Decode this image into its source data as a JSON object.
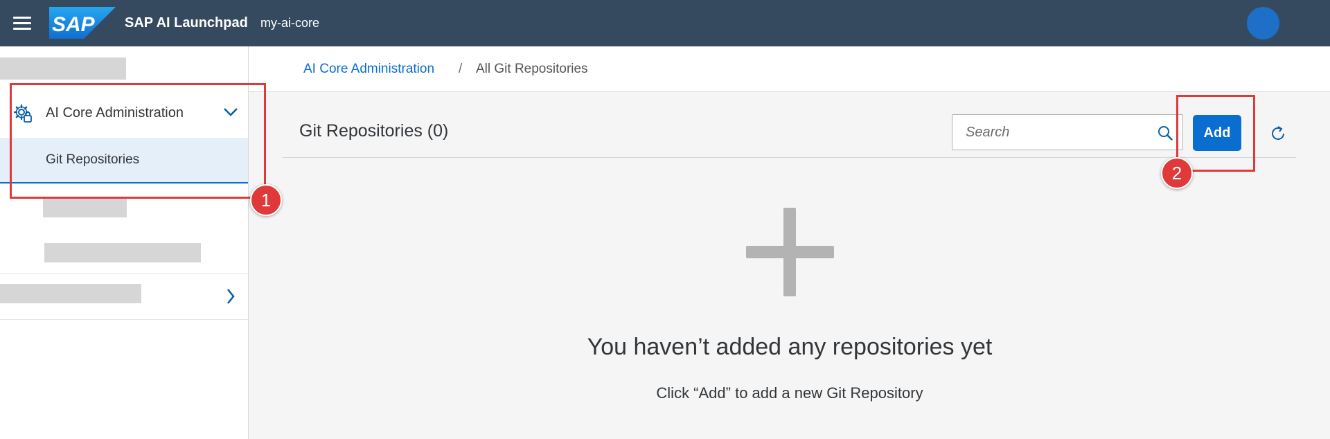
{
  "shell": {
    "app_title": "SAP AI Launchpad",
    "tenant": "my-ai-core",
    "logo_text": "SAP",
    "colors": {
      "bar": "#354a5f",
      "avatar": "#1d6fc8",
      "logo": "#1a8fdb"
    }
  },
  "sidebar": {
    "group_label": "AI Core Administration",
    "group_expanded": true,
    "active_item": "Git Repositories",
    "icons": {
      "group": "settings-gear-icon",
      "expand": "chevron-down-icon",
      "collapsed": "chevron-right-icon"
    }
  },
  "breadcrumb": {
    "parent": "AI Core Administration",
    "separator": "/",
    "current": "All Git Repositories"
  },
  "toolbar": {
    "title": "Git Repositories (0)",
    "search_placeholder": "Search",
    "add_label": "Add",
    "icons": {
      "search": "search-icon",
      "refresh": "refresh-icon"
    }
  },
  "empty_state": {
    "icon": "plus-icon",
    "title": "You haven’t added any repositories yet",
    "description": "Click “Add” to add a new Git Repository"
  },
  "annotations": {
    "badge_1": "1",
    "badge_2": "2",
    "color": "#e0393a"
  }
}
